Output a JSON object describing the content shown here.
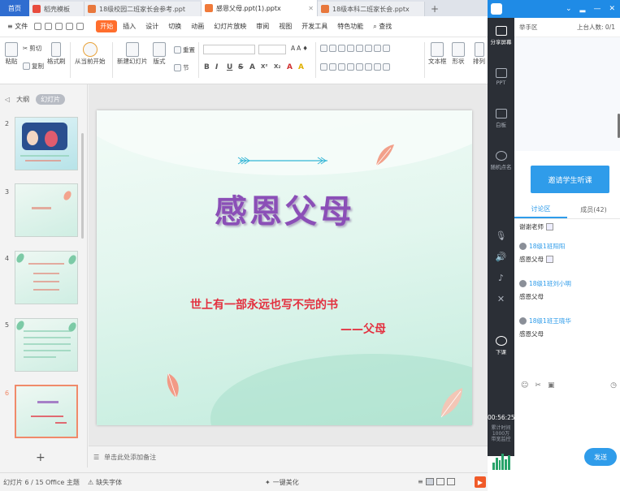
{
  "tabs": {
    "home": "首页",
    "items": [
      {
        "label": "稻壳模板",
        "color": "#e84c3d"
      },
      {
        "label": "18级校园二班家长会参考.ppt",
        "color": "#e8783d"
      },
      {
        "label": "感恩父母.ppt(1).pptx",
        "color": "#f07a3a"
      },
      {
        "label": "18级本科二班家长会.pptx",
        "color": "#e8783d"
      }
    ],
    "plus": "+"
  },
  "menu": {
    "file": "≡ 文件",
    "items": [
      "开始",
      "插入",
      "设计",
      "切换",
      "动画",
      "幻灯片放映",
      "审阅",
      "视图",
      "开发工具",
      "特色功能"
    ],
    "active": "开始",
    "search": "查找"
  },
  "ribbon": {
    "paste": "粘贴",
    "cut": "剪切",
    "copy": "复制",
    "format_painter": "格式刷",
    "from_start": "从当前开始",
    "new_slide": "新建幻灯片",
    "layout": "版式",
    "section": "节",
    "reset": "重置",
    "format_buttons": [
      "B",
      "I",
      "U",
      "S",
      "A",
      "X²",
      "X₂",
      "A",
      "A"
    ],
    "textbox": "文本框",
    "shape": "形状",
    "arrange": "排列"
  },
  "thumbs": {
    "tab_outline": "大纲",
    "tab_slides": "幻灯片",
    "numbers": [
      "2",
      "3",
      "4",
      "5",
      "6"
    ],
    "add": "+"
  },
  "slide": {
    "title": "感恩父母",
    "subtitle": "世上有一部永远也写不完的书",
    "author": "——父母"
  },
  "notes": {
    "placeholder": "单击此处添加备注"
  },
  "status": {
    "slide_count": "幻灯片 6 / 15",
    "theme": "Office 主题",
    "missing_font": "缺失字体",
    "beautify": "一键美化",
    "zoom": "61%",
    "minus": "−",
    "plus": "+"
  },
  "classroom": {
    "tools": [
      "分享屏幕",
      "PPT",
      "白板",
      "随机点名",
      "下课"
    ],
    "area_label": "举手区",
    "online": "上台人数: 0/1",
    "invite": "邀请学生听课",
    "tab_discussion": "讨论区",
    "tab_members": "成员(42)",
    "messages": [
      {
        "name": "",
        "text": "谢谢老师"
      },
      {
        "name": "18级1班阳阳",
        "text": "感恩父母"
      },
      {
        "name": "18级1班刘小明",
        "text": "感恩父母"
      },
      {
        "name": "18级1班王晓华",
        "text": "感恩父母"
      }
    ],
    "timer": "00:56:25",
    "timer_sub": "累计时间\n1000万\n带宽监控",
    "send": "发送"
  },
  "colors": {
    "accent": "#ff6e2d",
    "title": "#8b4fb7",
    "subtitle": "#e3303f",
    "panel_blue": "#2f9cea"
  }
}
